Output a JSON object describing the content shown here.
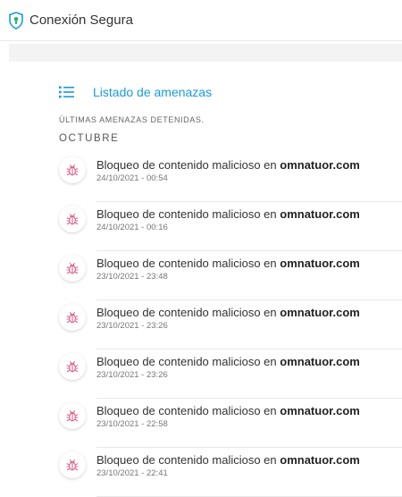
{
  "header": {
    "title": "Conexión Segura"
  },
  "section": {
    "list_label": "Listado de amenazas",
    "caption": "ÚLTIMAS AMENAZAS DETENIDAS.",
    "month": "OCTUBRE"
  },
  "colors": {
    "accent": "#1a9bd7",
    "bug": "#d9658c",
    "shield": "#1a9bd7"
  },
  "threats": [
    {
      "msg": "Bloqueo de contenido malicioso en ",
      "domain": "omnatuor.com",
      "time": "24/10/2021 - 00:54"
    },
    {
      "msg": "Bloqueo de contenido malicioso en ",
      "domain": "omnatuor.com",
      "time": "24/10/2021 - 00:16"
    },
    {
      "msg": "Bloqueo de contenido malicioso en ",
      "domain": "omnatuor.com",
      "time": "23/10/2021 - 23:48"
    },
    {
      "msg": "Bloqueo de contenido malicioso en ",
      "domain": "omnatuor.com",
      "time": "23/10/2021 - 23:26"
    },
    {
      "msg": "Bloqueo de contenido malicioso en ",
      "domain": "omnatuor.com",
      "time": "23/10/2021 - 23:26"
    },
    {
      "msg": "Bloqueo de contenido malicioso en ",
      "domain": "omnatuor.com",
      "time": "23/10/2021 - 22:58"
    },
    {
      "msg": "Bloqueo de contenido malicioso en ",
      "domain": "omnatuor.com",
      "time": "23/10/2021 - 22:41"
    }
  ]
}
